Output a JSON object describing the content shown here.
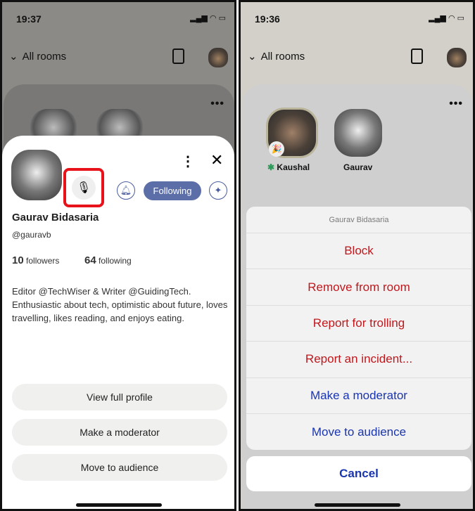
{
  "left": {
    "time": "19:37",
    "header": {
      "rooms_label": "All rooms"
    },
    "profile": {
      "name": "Gaurav Bidasaria",
      "handle": "@gauravb",
      "followers_count": "10",
      "followers_label": "followers",
      "following_count": "64",
      "following_label": "following",
      "bio": "Editor @TechWiser & Writer @GuidingTech. Enthusiastic about tech, optimistic about future, loves travelling, likes reading, and enjoys eating.",
      "following_button": "Following"
    },
    "actions": [
      "View full profile",
      "Make a moderator",
      "Move to audience"
    ],
    "highlight_color": "#e8121a"
  },
  "right": {
    "time": "19:36",
    "header": {
      "rooms_label": "All rooms"
    },
    "speakers": [
      {
        "name": "Kaushal"
      },
      {
        "name": "Gaurav"
      }
    ],
    "action_sheet": {
      "title": "Gaurav Bidasaria",
      "items": [
        {
          "label": "Block",
          "style": "destructive"
        },
        {
          "label": "Remove from room",
          "style": "destructive"
        },
        {
          "label": "Report for trolling",
          "style": "destructive"
        },
        {
          "label": "Report an incident...",
          "style": "destructive"
        },
        {
          "label": "Make a moderator",
          "style": "default"
        },
        {
          "label": "Move to audience",
          "style": "default"
        }
      ],
      "cancel": "Cancel"
    },
    "colors": {
      "destructive": "#c0171c",
      "default": "#1a35b0"
    }
  }
}
